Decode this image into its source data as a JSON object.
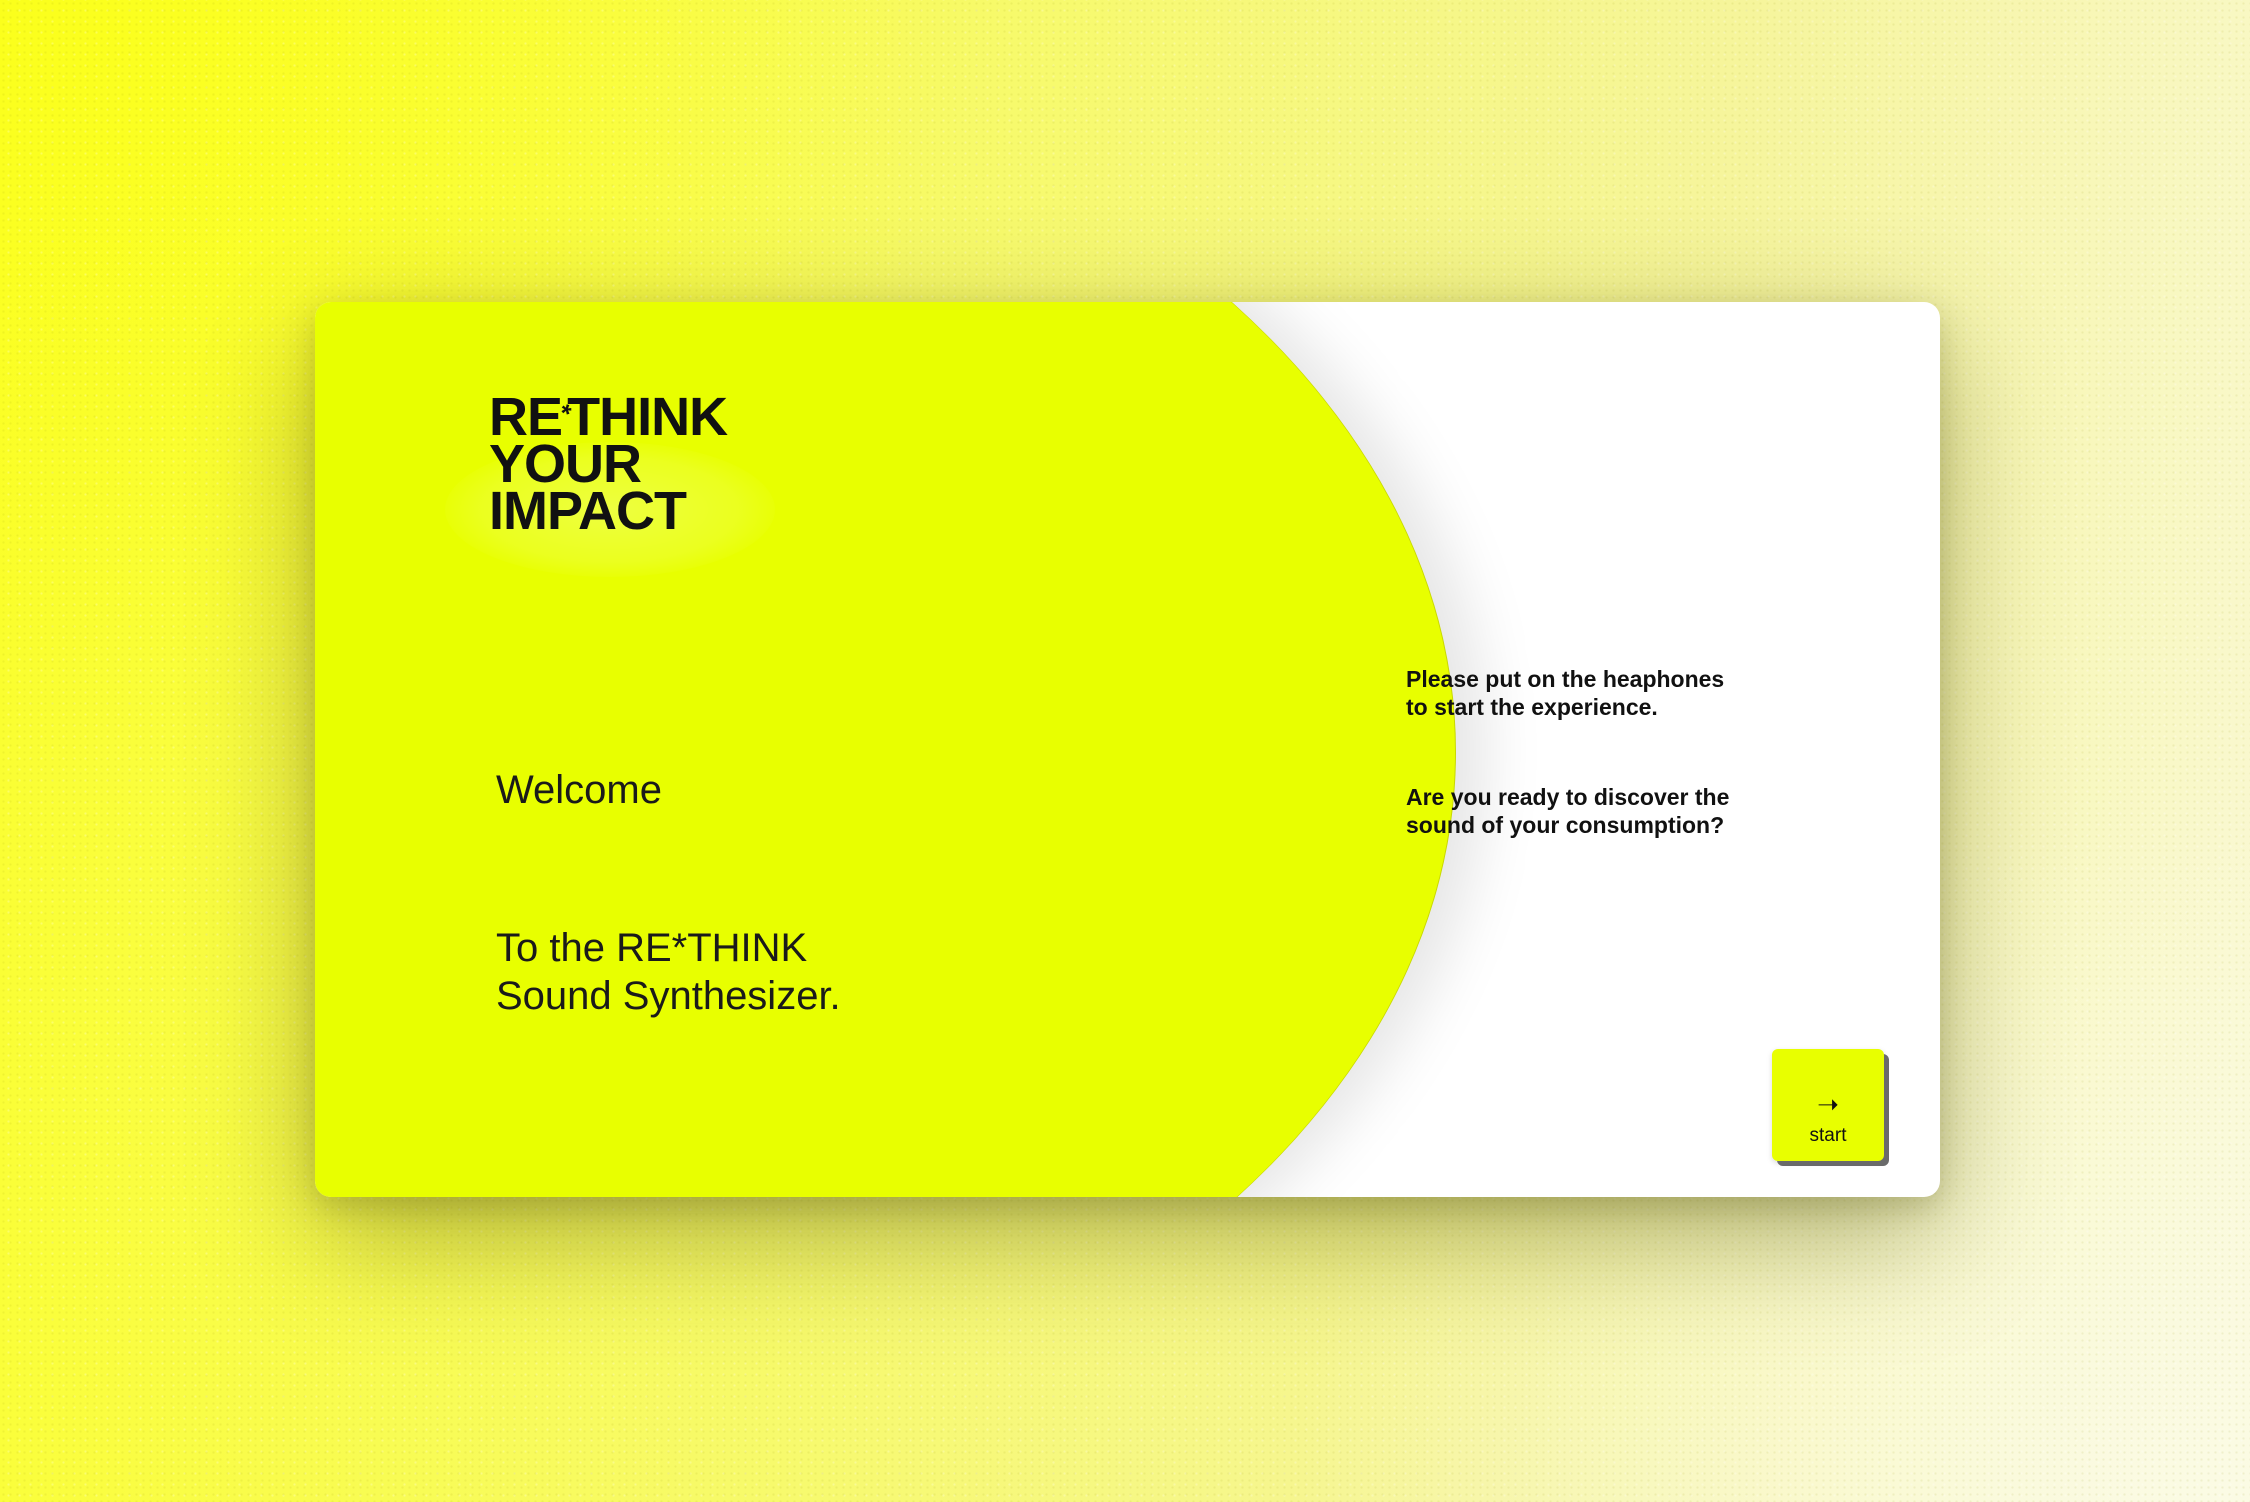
{
  "logo": {
    "line1_a": "RE",
    "line1_star": "*",
    "line1_b": "THINK",
    "line2": "YOUR",
    "line3": "IMPACT"
  },
  "welcome": {
    "heading": "Welcome",
    "tagline_prefix": "To the ",
    "tagline_brand": "RE*THINK",
    "tagline_line2": "Sound Synthesizer."
  },
  "messages": {
    "headphones_line1": "Please put on the heaphones",
    "headphones_line2": "to start the experience.",
    "ready_line1": "Are you ready to discover the",
    "ready_line2": "sound of your consumption?"
  },
  "start_button": {
    "icon": "arrow-right-icon",
    "label": "start"
  },
  "colors": {
    "accent": "#e8ff00",
    "text": "#111111",
    "card": "#ffffff"
  }
}
